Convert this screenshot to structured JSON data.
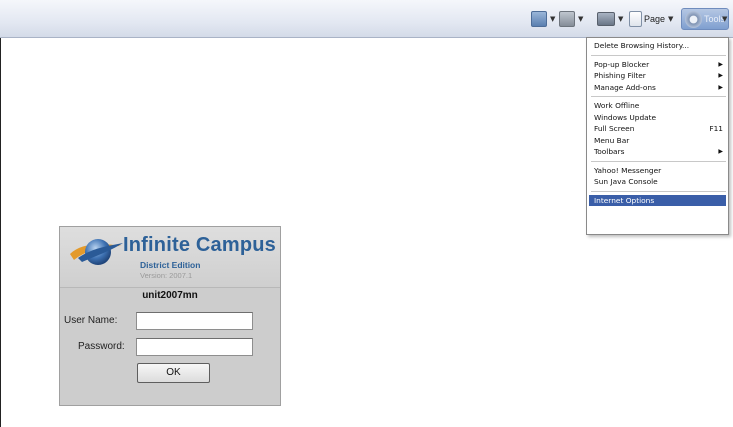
{
  "toolbar": {
    "page_label": "Page",
    "tools_label": "Tools",
    "icons": [
      "home-icon",
      "feed-icon",
      "print-icon",
      "page-icon",
      "gear-icon"
    ]
  },
  "tools_menu": {
    "items": [
      {
        "label": "Delete Browsing History..."
      },
      {
        "label": "Pop-up Blocker"
      },
      {
        "label": "Phishing Filter"
      },
      {
        "label": "Manage Add-ons"
      },
      {
        "label": "Work Offline"
      },
      {
        "label": "Windows Update"
      },
      {
        "label": "Full Screen",
        "shortcut": "F11"
      },
      {
        "label": "Menu Bar"
      },
      {
        "label": "Toolbars"
      },
      {
        "label": "Yahoo! Messenger"
      },
      {
        "label": "Sun Java Console"
      },
      {
        "label": "Internet Options"
      }
    ]
  },
  "login": {
    "brand": "Infinite Campus",
    "edition": "District Edition",
    "version": "Version: 2007.1",
    "site": "unit2007mn",
    "username_label": "User Name:",
    "username_value": "",
    "password_label": "Password:",
    "password_value": "",
    "ok_label": "OK"
  },
  "colors": {
    "brand_blue": "#2d6198",
    "menu_highlight": "#3a5ea8",
    "panel_gray": "#cdcdcd"
  }
}
